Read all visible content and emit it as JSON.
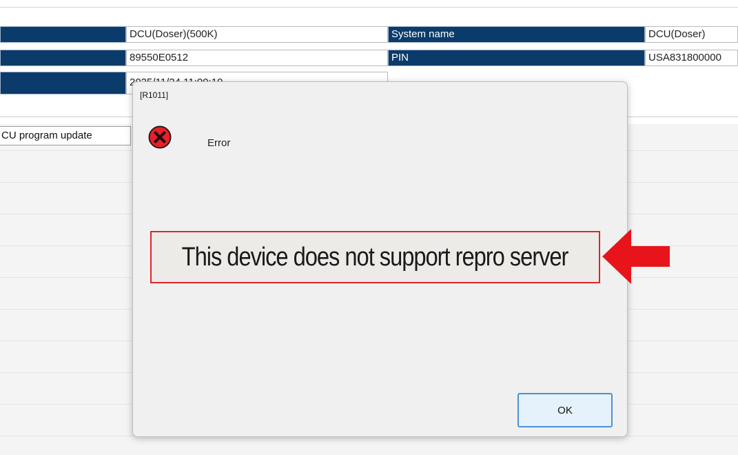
{
  "info_table": {
    "row1": {
      "value1": "DCU(Doser)(500K)",
      "label2": "System name",
      "value2": "DCU(Doser)"
    },
    "row2": {
      "value1": "89550E0512",
      "label2": "PIN",
      "value2": "USA831800000"
    },
    "row3": {
      "value1": "2025/11/24 11:00:10"
    }
  },
  "ecu_tab": {
    "label": "CU program update"
  },
  "dialog": {
    "title": "[R1011]",
    "icon": "error-circle-x-icon",
    "heading": "Error",
    "message": "This device does not support repro server",
    "ok_label": "OK"
  },
  "annotation": {
    "arrow_color": "#e8141b",
    "highlight_color": "#e0232a"
  },
  "colors": {
    "header_blue": "#0b3b6a"
  }
}
